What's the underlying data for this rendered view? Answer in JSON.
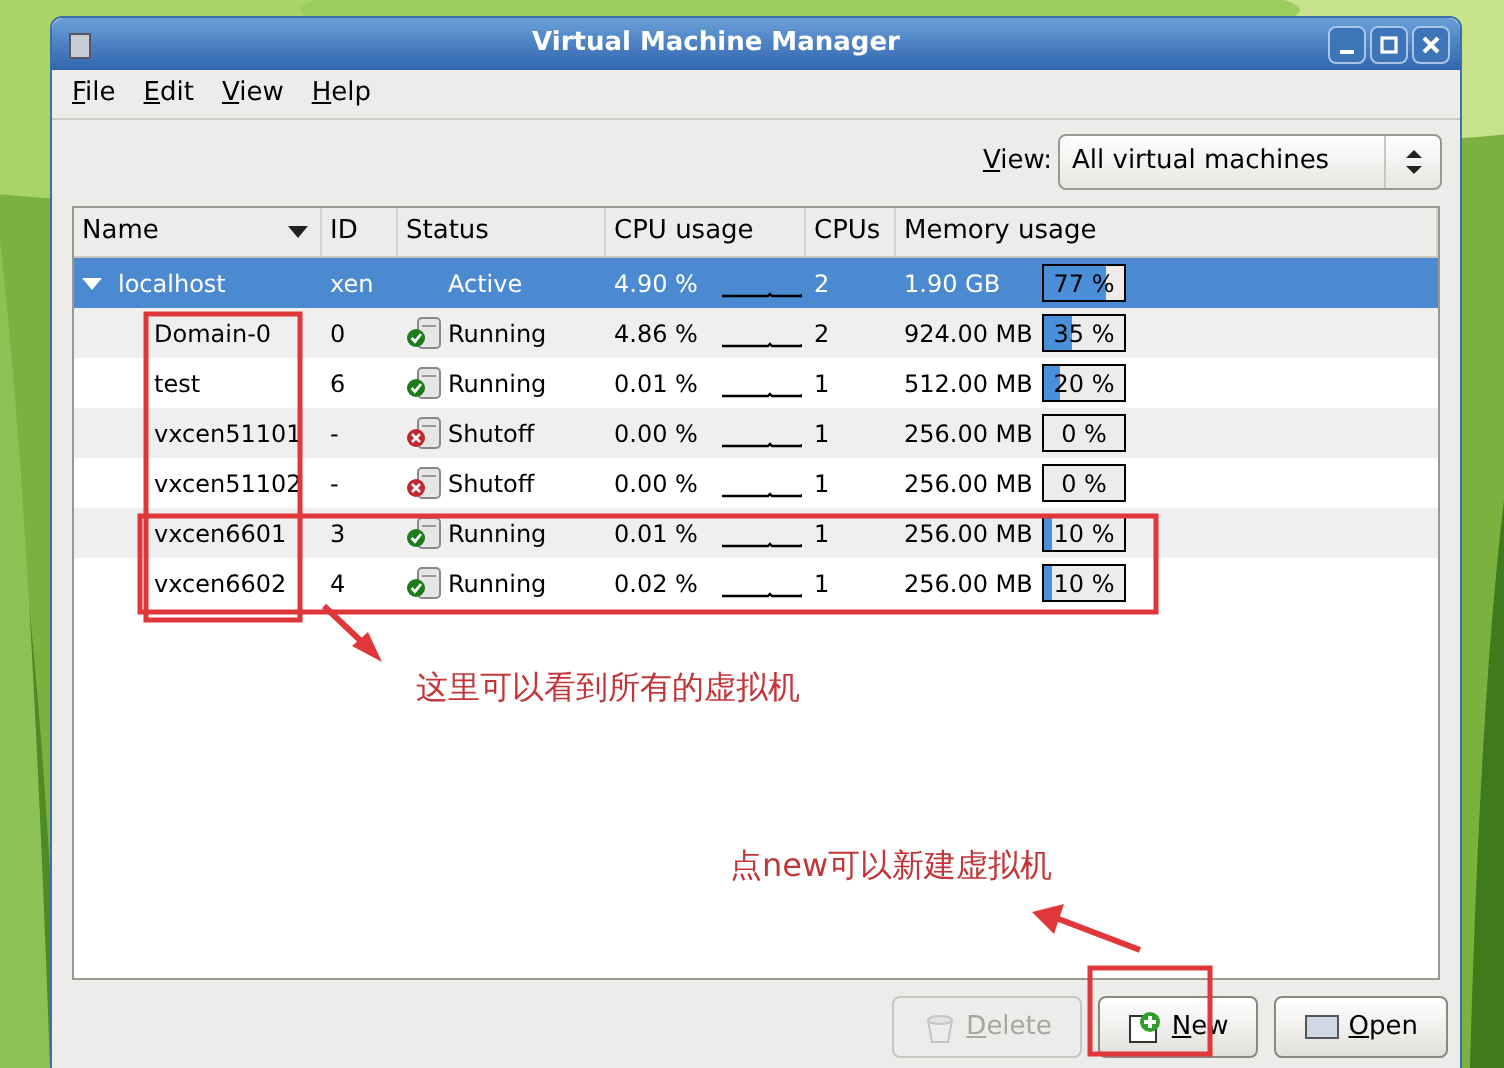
{
  "window": {
    "title": "Virtual Machine Manager"
  },
  "menu": [
    {
      "mnemonic": "F",
      "rest": "ile"
    },
    {
      "mnemonic": "E",
      "rest": "dit"
    },
    {
      "mnemonic": "V",
      "rest": "iew"
    },
    {
      "mnemonic": "H",
      "rest": "elp"
    }
  ],
  "view_filter": {
    "mnemonic": "V",
    "rest": "iew:",
    "value": "All virtual machines"
  },
  "columns": [
    "Name",
    "ID",
    "Status",
    "CPU usage",
    "CPUs",
    "Memory usage"
  ],
  "rows": [
    {
      "name": "localhost",
      "id": "xen",
      "status": "Active",
      "kind": "host",
      "cpu": "4.90 %",
      "cpus": "2",
      "memory": "1.90 GB",
      "level": 0.77,
      "reading": "77 %",
      "selected": true,
      "expanded": true,
      "children": [
        {
          "name": "Domain-0",
          "id": "0",
          "status": "Running",
          "kind": "running",
          "cpu": "4.86 %",
          "cpus": "2",
          "memory": "924.00 MB",
          "level": 0.35,
          "reading": "35 %",
          "selected": false
        },
        {
          "name": "test",
          "id": "6",
          "status": "Running",
          "kind": "running",
          "cpu": "0.01 %",
          "cpus": "1",
          "memory": "512.00 MB",
          "level": 0.2,
          "reading": "20 %",
          "selected": false
        },
        {
          "name": "vxcen51101",
          "id": "-",
          "status": "Shutoff",
          "kind": "shutoff",
          "cpu": "0.00 %",
          "cpus": "1",
          "memory": "256.00 MB",
          "level": 0,
          "reading": "0 %",
          "selected": false
        },
        {
          "name": "vxcen51102",
          "id": "-",
          "status": "Shutoff",
          "kind": "shutoff",
          "cpu": "0.00 %",
          "cpus": "1",
          "memory": "256.00 MB",
          "level": 0,
          "reading": "0 %",
          "selected": false
        },
        {
          "name": "vxcen6601",
          "id": "3",
          "status": "Running",
          "kind": "running",
          "cpu": "0.01 %",
          "cpus": "1",
          "memory": "256.00 MB",
          "level": 0.1,
          "reading": "10 %",
          "selected": false
        },
        {
          "name": "vxcen6602",
          "id": "4",
          "status": "Running",
          "kind": "running",
          "cpu": "0.02 %",
          "cpus": "1",
          "memory": "256.00 MB",
          "level": 0.1,
          "reading": "10 %",
          "selected": false
        }
      ]
    }
  ],
  "buttons": [
    {
      "kind": "delete",
      "mnemonic": "D",
      "rest": "elete",
      "disabled": true
    },
    {
      "kind": "new",
      "mnemonic": "N",
      "rest": "ew",
      "disabled": false
    },
    {
      "kind": "open",
      "mnemonic": "O",
      "rest": "pen",
      "disabled": false
    }
  ],
  "annotations": [
    {
      "text": "这里可以看到所有的虚拟机"
    },
    {
      "text": "点new可以新建虚拟机"
    }
  ]
}
